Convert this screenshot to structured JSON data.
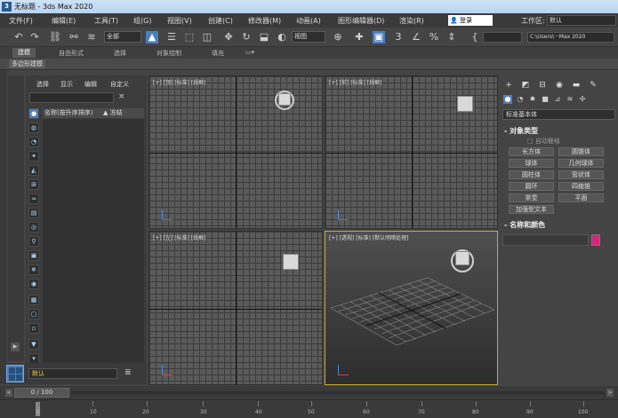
{
  "window": {
    "title": "无标题 - 3ds Max 2020",
    "app_icon": "3"
  },
  "menu": {
    "items": [
      "文件(F)",
      "编辑(E)",
      "工具(T)",
      "组(G)",
      "视图(V)",
      "创建(C)",
      "修改器(M)",
      "动画(A)",
      "图形编辑器(D)",
      "渲染(R)"
    ],
    "sign_in": "登录",
    "workspace_label": "工作区:",
    "workspace_value": "默认"
  },
  "toolbar": {
    "selection_filter": "全部",
    "reference_coord": "视图",
    "project_path": "C:\\Users\\···Max 2020"
  },
  "ribbon": {
    "tabs": [
      "建模",
      "自由形式",
      "选择",
      "对象绘制",
      "填充"
    ],
    "active_tab": "建模",
    "sub": "多边形建模"
  },
  "scene_explorer": {
    "menu": [
      "选择",
      "显示",
      "编辑",
      "自定义"
    ],
    "clear_icon": "×",
    "column_name": "名称(按升序排序)",
    "column_frozen": "▲ 冻结"
  },
  "layer": {
    "name": "默认"
  },
  "viewports": {
    "top": "[+] [顶] [标准] [线框]",
    "front": "[+] [前] [标准] [线框]",
    "left": "[+] [左] [标准] [线框]",
    "perspective": "[+] [透视] [标准] [默认明暗处理]"
  },
  "command_panel": {
    "category_dropdown": "标准基本体",
    "object_type_title": "对象类型",
    "autogrid": "自动栅格",
    "buttons": [
      "长方体",
      "圆锥体",
      "球体",
      "几何球体",
      "圆柱体",
      "管状体",
      "圆环",
      "四棱锥",
      "茶壶",
      "平面",
      "加强型文本"
    ],
    "name_color_title": "名称和颜色",
    "swatch_color": "#d8247e"
  },
  "timeline": {
    "frame_display": "0 / 100",
    "prev_icon": "<",
    "next_icon": ">",
    "ticks": [
      "0",
      "10",
      "20",
      "30",
      "40",
      "50",
      "60",
      "70",
      "80",
      "90",
      "100"
    ]
  }
}
